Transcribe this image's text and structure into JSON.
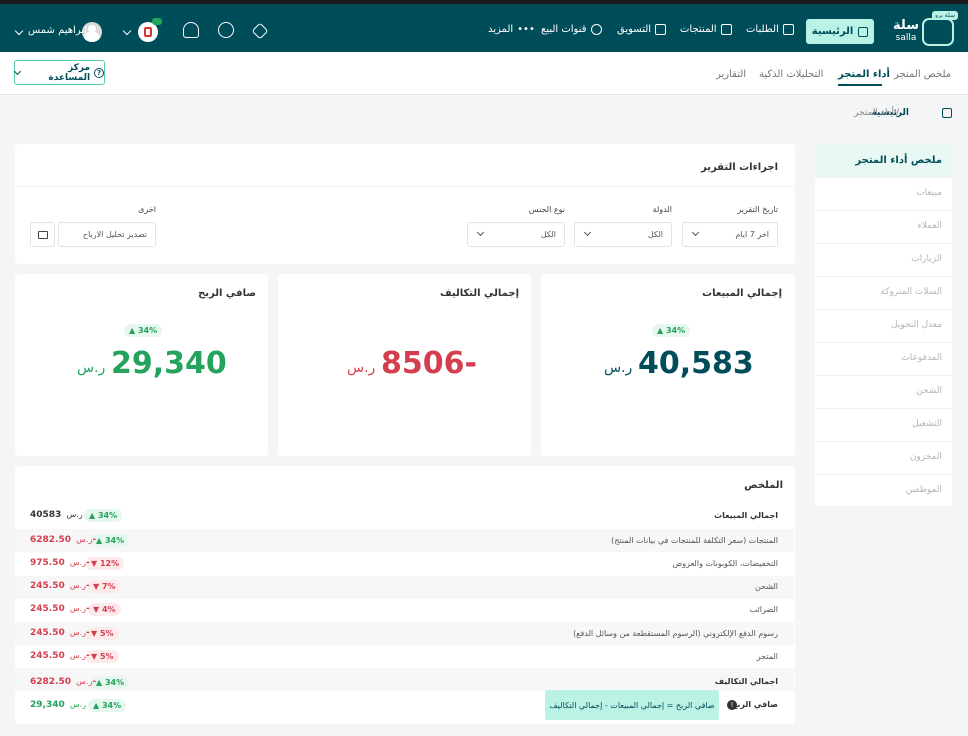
{
  "topbar": {
    "logo": {
      "tag": "سلة برو",
      "name_ar": "سلة",
      "name_en": "salla"
    },
    "home_label": "الرئيسية",
    "nav": [
      "الطلبات",
      "المنتجات",
      "التسويق",
      "قنوات البيع",
      "المزيد"
    ],
    "user_name": "إبراهيم شمس"
  },
  "subnav": {
    "tabs": [
      "ملخص المتجر",
      "أداء المتجر",
      "التحليلات الذكية",
      "التقارير"
    ],
    "help": "مركز المساعدة"
  },
  "breadcrumb": {
    "home": "الرئيسية",
    "sep": "/",
    "current": "أداء المتجر"
  },
  "sidebar": {
    "items": [
      "ملخص أداء المتجر",
      "مبيعات",
      "العملاء",
      "الزيارات",
      "السلات المتروكة",
      "معدل التحويل",
      "المدفوعات",
      "الشحن",
      "التشغيل",
      "المخزون",
      "الموظفين"
    ]
  },
  "report": {
    "title": "اجراءات التقرير",
    "date_label": "تاريخ التقرير",
    "date_value": "اخر 7 ايام",
    "country_label": "الدولة",
    "country_value": "الكل",
    "gender_label": "نوع الجنس",
    "gender_value": "الكل",
    "other_label": "اخرى",
    "export_label": "تصدير تحليل الارباح"
  },
  "cards": [
    {
      "title": "إجمالي المبيعات",
      "pct": "34%",
      "value": "40,583",
      "currency": "ر.س"
    },
    {
      "title": "إجمالي التكاليف",
      "value": "8506-",
      "currency": "ر.س"
    },
    {
      "title": "صافي الربح",
      "pct": "34%",
      "value": "29,340",
      "currency": "ر.س"
    }
  ],
  "summary": {
    "title": "الملخص",
    "rows": [
      {
        "label": "اجمالي المبيعات",
        "pct": "34%",
        "amount": "40583",
        "currency": "ر.س"
      },
      {
        "label": "المنتجات (سعر التكلفة للمنتجات في بيانات المنتج)",
        "pct": "34%",
        "amount": "6282.50-",
        "currency": "ر.س"
      },
      {
        "label": "التخفيضات، الكوبونات والعروض",
        "pct": "12%",
        "amount": "975.50-",
        "currency": "ر.س"
      },
      {
        "label": "الشحن",
        "pct": "7%",
        "amount": "245.50-",
        "currency": "ر.س"
      },
      {
        "label": "الضرائب",
        "pct": "4%",
        "amount": "245.50-",
        "currency": "ر.س"
      },
      {
        "label": "رسوم الدفع الإلكتروني (الرسوم المستقطعة من وسائل الدفع)",
        "pct": "5%",
        "amount": "245.50-",
        "currency": "ر.س"
      },
      {
        "label": "المتجر",
        "pct": "5%",
        "amount": "245.50-",
        "currency": "ر.س"
      },
      {
        "label": "اجمالي التكاليف",
        "pct": "34%",
        "amount": "6282.50-",
        "currency": "ر.س"
      },
      {
        "label": "صافي الربح",
        "pct": "34%",
        "amount": "29,340",
        "currency": "ر.س"
      }
    ],
    "tooltip": "صافي الربح = إجمالي المبيعات - إجمالي التكاليف"
  },
  "colors": {
    "brand": "#004d5a",
    "accent": "#baf3e6",
    "positive": "#23a35b",
    "negative": "#d33f4e"
  }
}
